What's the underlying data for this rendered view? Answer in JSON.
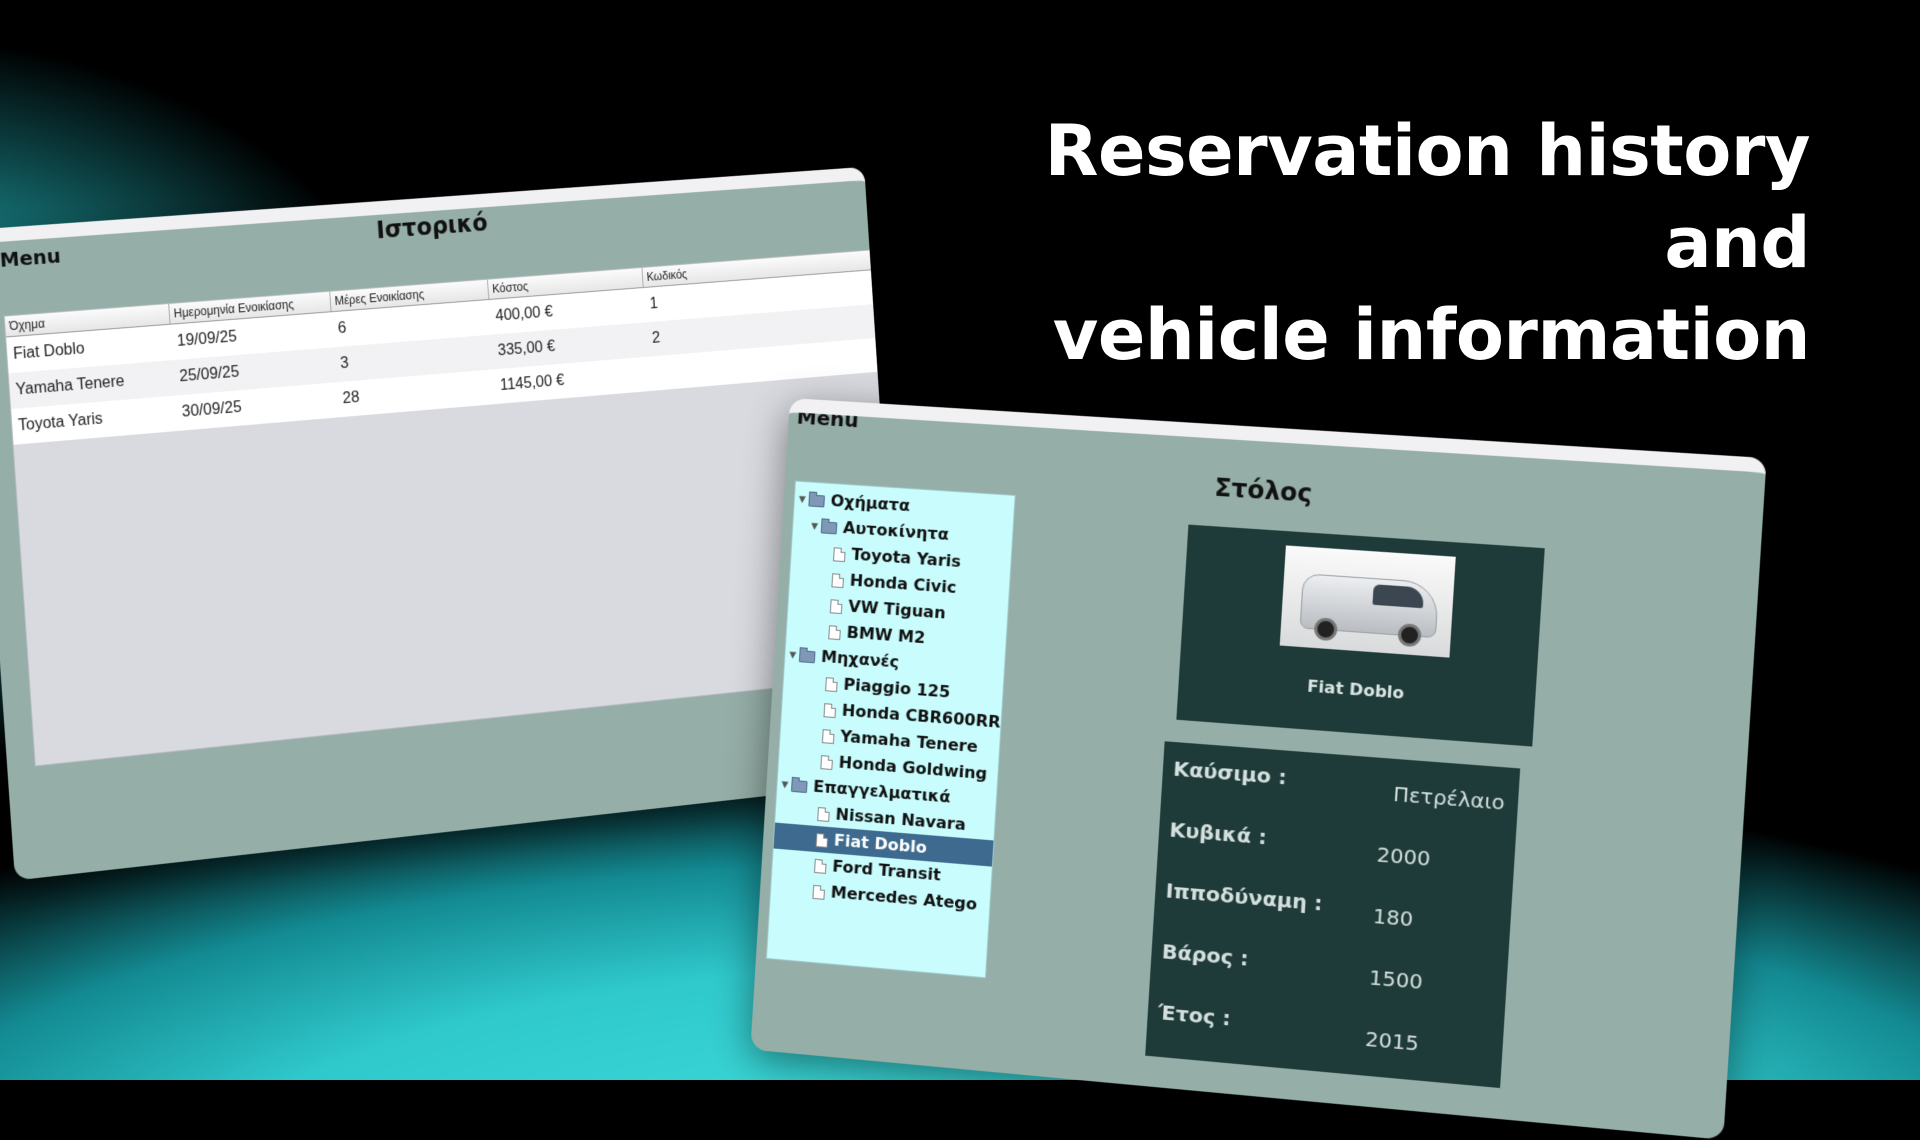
{
  "headline": {
    "line1": "Reservation history and",
    "line2": "vehicle information"
  },
  "history_window": {
    "menu": "Menu",
    "title": "Ιστορικό",
    "columns": [
      "Όχημα",
      "Ημερομηνία Ενοικίασης",
      "Μέρες Ενοικίασης",
      "Κόστος",
      "Κωδικός"
    ],
    "rows": [
      {
        "vehicle": "Fiat Doblo",
        "date": "19/09/25",
        "days": "6",
        "cost": "400,00 €",
        "code": "1"
      },
      {
        "vehicle": "Yamaha Tenere",
        "date": "25/09/25",
        "days": "3",
        "cost": "335,00 €",
        "code": "2"
      },
      {
        "vehicle": "Toyota Yaris",
        "date": "30/09/25",
        "days": "28",
        "cost": "1145,00 €",
        "code": ""
      }
    ]
  },
  "fleet_window": {
    "menu": "Menu",
    "title": "Στόλος",
    "tree": {
      "root": "Οχήματα",
      "groups": [
        {
          "label": "Αυτοκίνητα",
          "items": [
            "Toyota Yaris",
            "Honda Civic",
            "VW Tiguan",
            "BMW M2"
          ]
        },
        {
          "label": "Μηχανές",
          "items": [
            "Piaggio 125",
            "Honda CBR600RR",
            "Yamaha Tenere",
            "Honda Goldwing"
          ]
        },
        {
          "label": "Επαγγελματικά",
          "items": [
            "Nissan Navara",
            "Fiat Doblo",
            "Ford Transit",
            "Mercedes Atego"
          ]
        }
      ],
      "selected": "Fiat Doblo"
    },
    "photo_caption": "Fiat Doblo",
    "info": [
      {
        "key": "Καύσιμο :",
        "value": "Πετρέλαιο"
      },
      {
        "key": "Κυβικά :",
        "value": "2000"
      },
      {
        "key": "Ιπποδύναμη :",
        "value": "180"
      },
      {
        "key": "Βάρος :",
        "value": "1500"
      },
      {
        "key": "Έτος :",
        "value": "2015"
      }
    ]
  },
  "colors": {
    "window_bg": "#95aea7",
    "panel_dark": "#1e3a39",
    "tree_bg": "#c9fcfd",
    "selection": "#3d6a8e",
    "accent_glow": "#35d8d6"
  }
}
